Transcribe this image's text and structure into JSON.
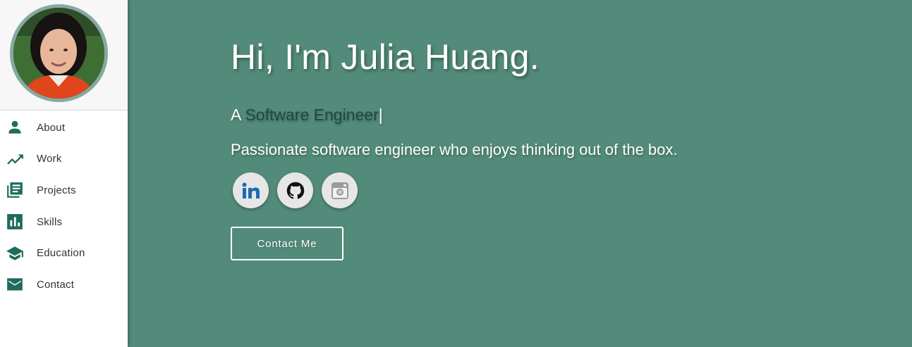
{
  "sidebar": {
    "items": [
      {
        "label": "About",
        "icon": "person-icon"
      },
      {
        "label": "Work",
        "icon": "trending-up-icon"
      },
      {
        "label": "Projects",
        "icon": "library-books-icon"
      },
      {
        "label": "Skills",
        "icon": "bar-chart-icon"
      },
      {
        "label": "Education",
        "icon": "graduation-cap-icon"
      },
      {
        "label": "Contact",
        "icon": "mail-icon"
      }
    ]
  },
  "hero": {
    "title": "Hi, I'm Julia Huang.",
    "subtitle_prefix": "A ",
    "role": "Software Engineer",
    "cursor": "|",
    "tagline": "Passionate software engineer who enjoys thinking out of the box.",
    "socials": [
      {
        "icon": "linkedin-icon"
      },
      {
        "icon": "github-icon"
      },
      {
        "icon": "instagram-icon"
      }
    ],
    "contact_button": "Contact Me"
  },
  "colors": {
    "accent": "#538b7a",
    "icon": "#1f6b5e",
    "role_text": "#1d4a3f"
  }
}
